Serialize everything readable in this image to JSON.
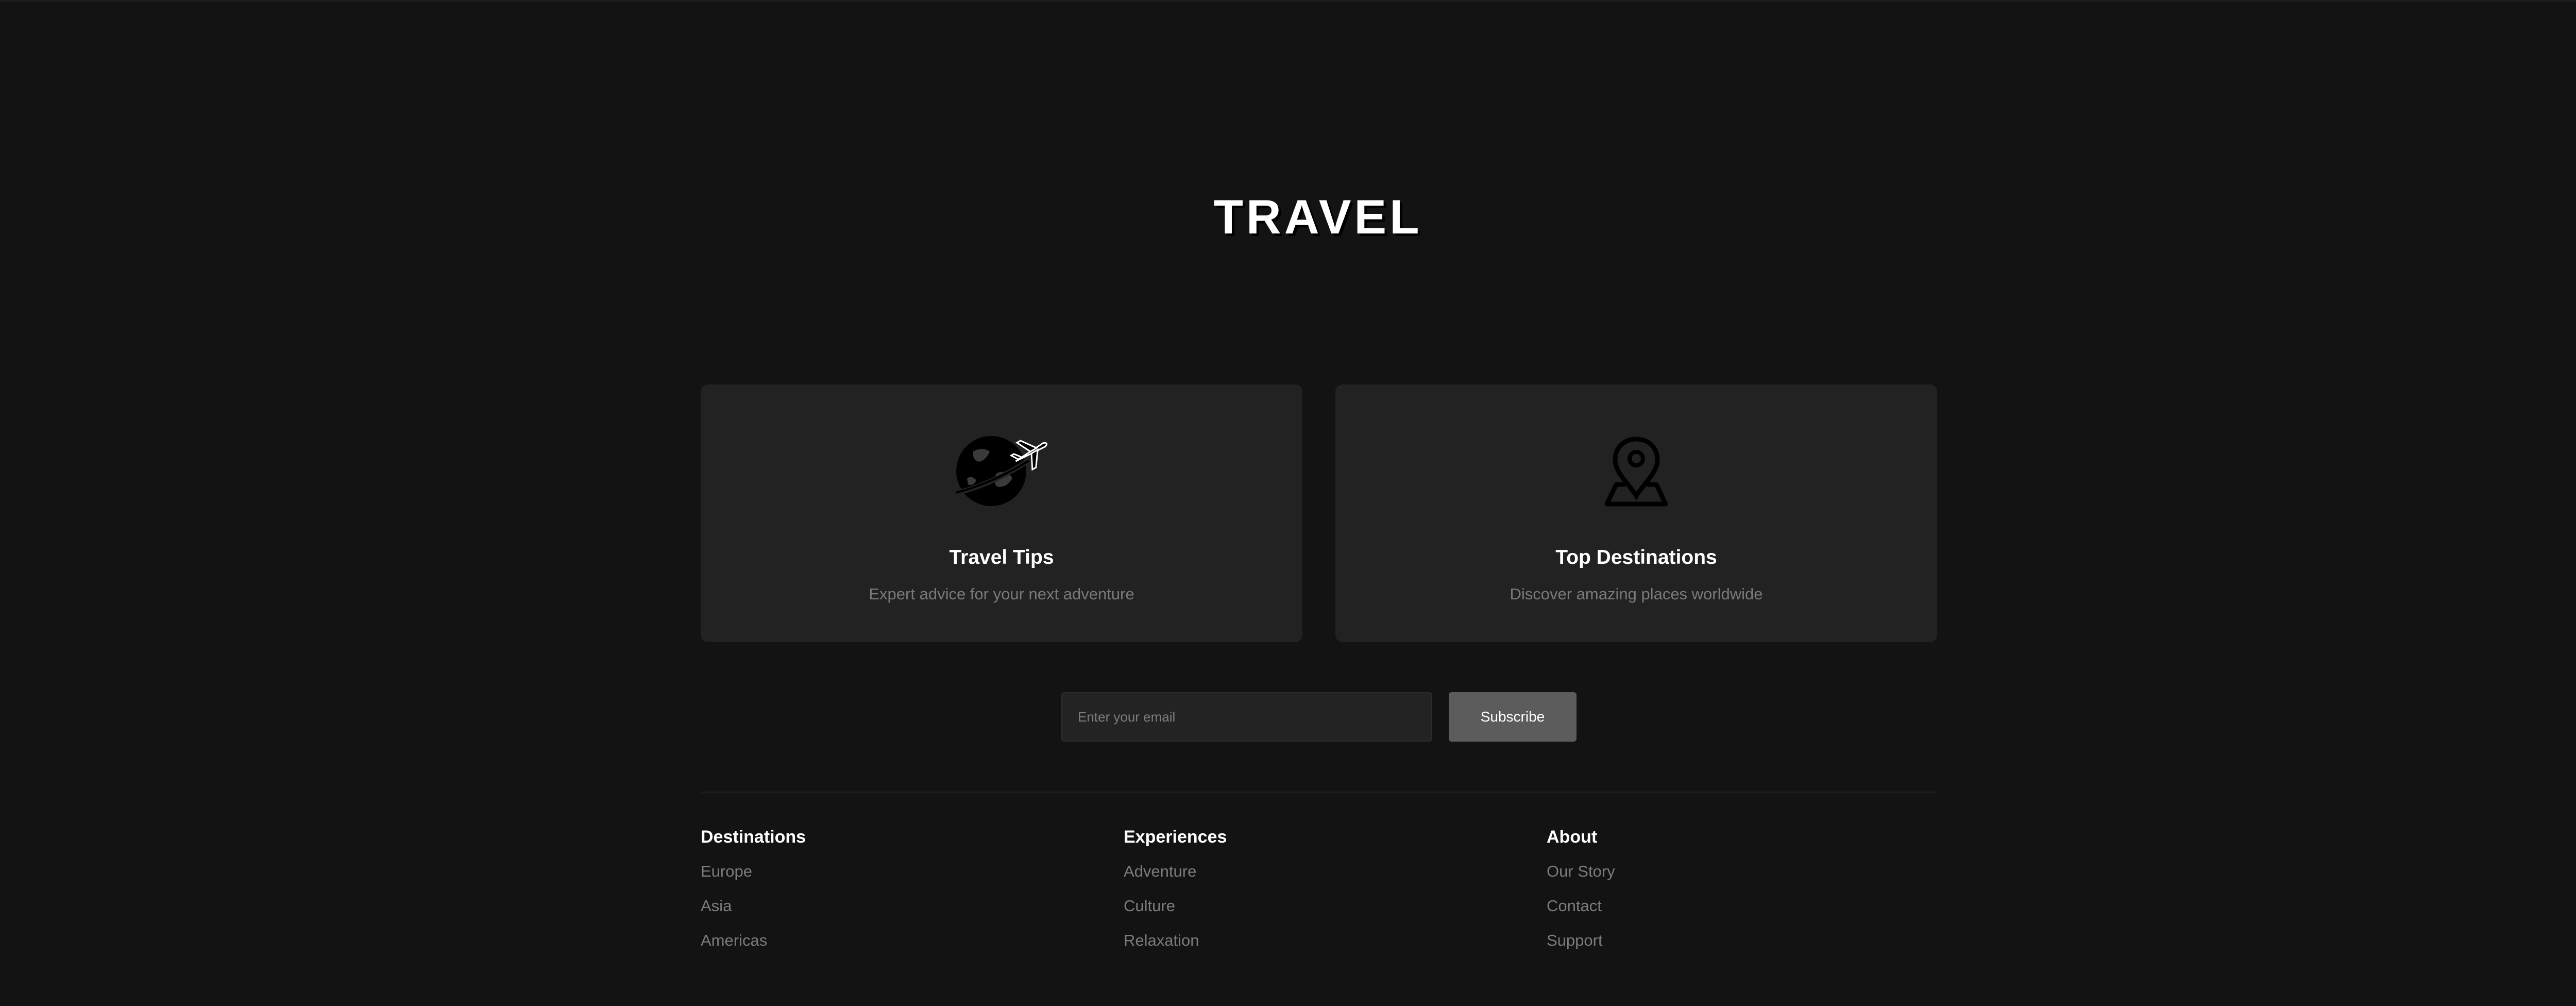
{
  "brand": {
    "logo_text": "TRAVEL"
  },
  "cards": [
    {
      "icon": "globe-airplane-icon",
      "title": "Travel Tips",
      "description": "Expert advice for your next adventure"
    },
    {
      "icon": "map-pin-icon",
      "title": "Top Destinations",
      "description": "Discover amazing places worldwide"
    }
  ],
  "newsletter": {
    "email_placeholder": "Enter your email",
    "email_value": "",
    "subscribe_label": "Subscribe"
  },
  "footer": {
    "columns": [
      {
        "heading": "Destinations",
        "links": [
          "Europe",
          "Asia",
          "Americas"
        ]
      },
      {
        "heading": "Experiences",
        "links": [
          "Adventure",
          "Culture",
          "Relaxation"
        ]
      },
      {
        "heading": "About",
        "links": [
          "Our Story",
          "Contact",
          "Support"
        ]
      }
    ]
  },
  "colors": {
    "background": "#131313",
    "card": "#222222",
    "button": "#5c5c5c",
    "text_primary": "#ffffff",
    "text_muted": "#7a7a7a"
  }
}
